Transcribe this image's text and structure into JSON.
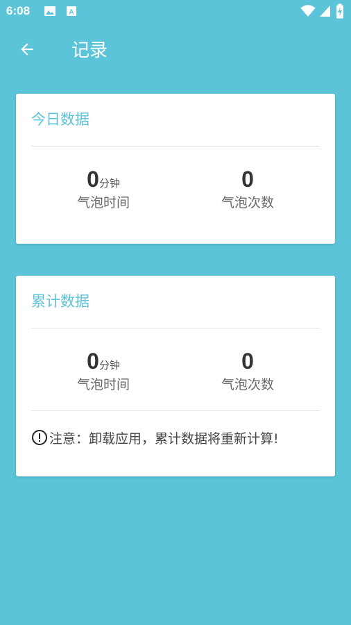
{
  "status_bar": {
    "time": "6:08",
    "icons": [
      "image-icon",
      "text-a-icon",
      "wifi-icon",
      "signal-icon",
      "battery-charging-icon"
    ]
  },
  "app_bar": {
    "title": "记录",
    "back_icon": "arrow-left-icon"
  },
  "today_card": {
    "title": "今日数据",
    "bubble_time": {
      "value": "0",
      "unit": "分钟",
      "label": "气泡时间"
    },
    "bubble_count": {
      "value": "0",
      "label": "气泡次数"
    }
  },
  "total_card": {
    "title": "累计数据",
    "bubble_time": {
      "value": "0",
      "unit": "分钟",
      "label": "气泡时间"
    },
    "bubble_count": {
      "value": "0",
      "label": "气泡次数"
    },
    "notice": "注意：卸载应用，累计数据将重新计算!",
    "notice_icon": "exclamation-circle-icon"
  },
  "colors": {
    "background": "#5cc4d8",
    "accent": "#5cc4d8",
    "card": "#ffffff"
  }
}
